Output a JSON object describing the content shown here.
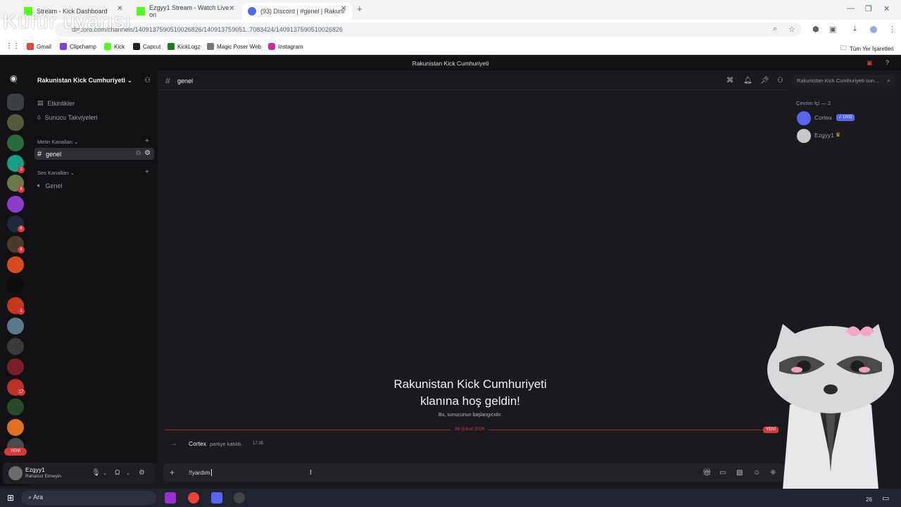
{
  "overlay_warning": "Küfür uyarısı",
  "browser": {
    "tabs": [
      {
        "label": "Stream - Kick Dashboard"
      },
      {
        "label": "Ezgyy1 Stream - Watch Live on"
      },
      {
        "label": "(93) Discord | #genel | Rakunist"
      }
    ],
    "address": "discord.com/channels/1409137590510026826/140913759051..7083424/1409137590510026826",
    "bookmarks": [
      "Gmail",
      "Clipchamp",
      "Kick",
      "Capcut",
      "KickLogz",
      "Magic Poser Web",
      "Instagram"
    ],
    "all_bookmarks": "Tüm Yer İşaretleri"
  },
  "discord": {
    "window_title": "Rakunistan Kick Cumhuriyeti",
    "server_name": "Rakunistan Kick Cumhuriyeti",
    "sidebar_top": [
      "Etkinlikler",
      "Sunucu Takviyeleri"
    ],
    "text_category": "Metin Kanalları",
    "text_channel": "genel",
    "voice_category": "Ses Kanalları",
    "voice_channel": "Genel",
    "server_badges": [
      "3",
      "8",
      "8",
      "6",
      "1",
      "17"
    ],
    "rail_new": "YENİ",
    "user": {
      "name": "Ezgyy1",
      "status": "Rahatsız Etmeyin"
    },
    "channel_header": "genel",
    "search_placeholder": "Rakunistan Kick Cumhuriyeti sun...",
    "welcome_title_1": "Rakunistan Kick Cumhuriyeti",
    "welcome_title_2": "klanına hoş geldin!",
    "welcome_sub": "Bu, sunucunun başlangıcıdır.",
    "date_divider": "28 Şubat 2026",
    "new_label": "YENİ",
    "join_message": {
      "name": "Cortex",
      "text": "partiye katıldı.",
      "time": "17:35"
    },
    "composer_text": "!!yardım",
    "members_header": "Çevrim İçi — 2",
    "members": [
      {
        "name": "Cortex",
        "tag": "✓ UYG"
      },
      {
        "name": "Ezgyy1"
      }
    ]
  },
  "taskbar": {
    "search": "Ara",
    "clock_partial": "26"
  },
  "colors": {
    "accent": "#5865f2",
    "danger": "#da373c",
    "online": "#23a55a",
    "kick": "#53fc18"
  }
}
